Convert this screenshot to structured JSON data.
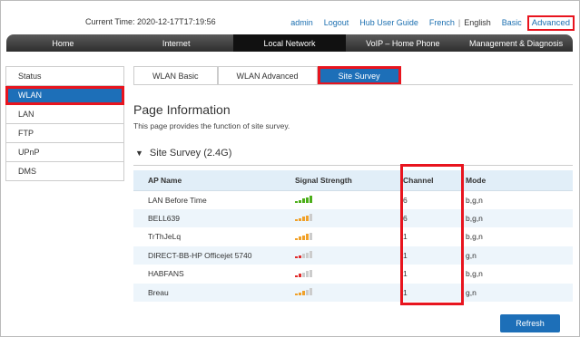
{
  "header": {
    "current_time_label": "Current Time:",
    "current_time_value": "2020-12-17T17:19:56",
    "links": {
      "admin": "admin",
      "logout": "Logout",
      "hub_user_guide": "Hub User Guide",
      "french": "French",
      "separator": "|",
      "english": "English",
      "basic": "Basic",
      "advanced": "Advanced"
    }
  },
  "nav": {
    "items": [
      "Home",
      "Internet",
      "Local Network",
      "VoIP – Home Phone",
      "Management & Diagnosis"
    ],
    "active": "Local Network"
  },
  "sidebar": {
    "items": [
      "Status",
      "WLAN",
      "LAN",
      "FTP",
      "UPnP",
      "DMS"
    ],
    "active": "WLAN"
  },
  "tabs": {
    "items": [
      "WLAN Basic",
      "WLAN Advanced",
      "Site Survey"
    ],
    "active": "Site Survey"
  },
  "page": {
    "title": "Page Information",
    "description": "This page provides the function of site survey.",
    "section_title": "Site Survey (2.4G)"
  },
  "table": {
    "headers": [
      "AP Name",
      "Signal Strength",
      "Channel",
      "Mode"
    ],
    "rows": [
      {
        "ap": "LAN Before Time",
        "signal_level": 5,
        "signal_color": "#4cae1a",
        "channel": "6",
        "mode": "b,g,n"
      },
      {
        "ap": "BELL639",
        "signal_level": 4,
        "signal_color": "#f0a12a",
        "channel": "6",
        "mode": "b,g,n"
      },
      {
        "ap": "TrThJeLq",
        "signal_level": 4,
        "signal_color": "#f0a12a",
        "channel": "1",
        "mode": "b,g,n"
      },
      {
        "ap": "DIRECT-BB-HP Officejet 5740",
        "signal_level": 2,
        "signal_color": "#e02b2b",
        "channel": "1",
        "mode": "g,n"
      },
      {
        "ap": "HABFANS",
        "signal_level": 2,
        "signal_color": "#e02b2b",
        "channel": "1",
        "mode": "b,g,n"
      },
      {
        "ap": "Breau",
        "signal_level": 3,
        "signal_color": "#f0a12a",
        "channel": "1",
        "mode": "g,n"
      }
    ]
  },
  "actions": {
    "refresh_label": "Refresh"
  },
  "colors": {
    "accent": "#1d6fb8",
    "highlight": "#e8141e",
    "link": "#1b6fb0"
  }
}
